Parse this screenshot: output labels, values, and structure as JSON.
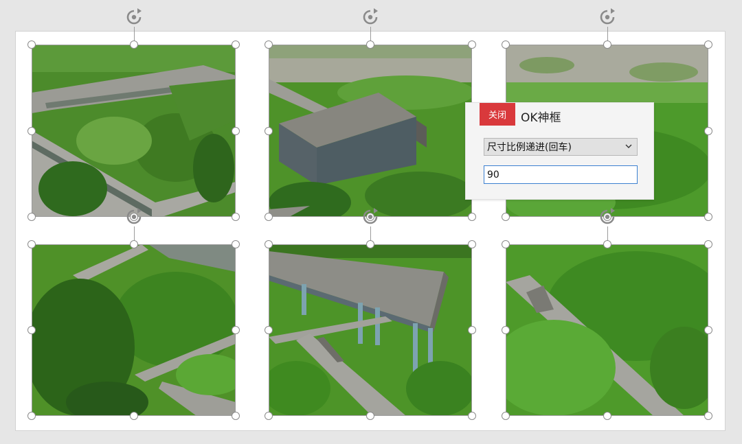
{
  "dialog": {
    "close_label": "关闭",
    "title": "OK神框",
    "mode_select": {
      "selected": "尺寸比例递进(回车)"
    },
    "value_input": {
      "value": "90"
    }
  },
  "colors": {
    "close_button": "#d9393c",
    "input_border": "#3a7fd0",
    "grass": "#4e8f2a",
    "path": "#9a9a94"
  },
  "icons": {
    "rotate": "rotate-handle-icon",
    "dropdown": "chevron-down-icon",
    "handle": "resize-handle"
  },
  "tiles": [
    {
      "name": "photo-tile-1",
      "scene": "aerial-boardwalk"
    },
    {
      "name": "photo-tile-2",
      "scene": "pavilion-in-grass"
    },
    {
      "name": "photo-tile-3",
      "scene": "wetland-reeds"
    },
    {
      "name": "photo-tile-4",
      "scene": "trees-and-steps"
    },
    {
      "name": "photo-tile-5",
      "scene": "elevated-walkway"
    },
    {
      "name": "photo-tile-6",
      "scene": "diagonal-path"
    }
  ]
}
